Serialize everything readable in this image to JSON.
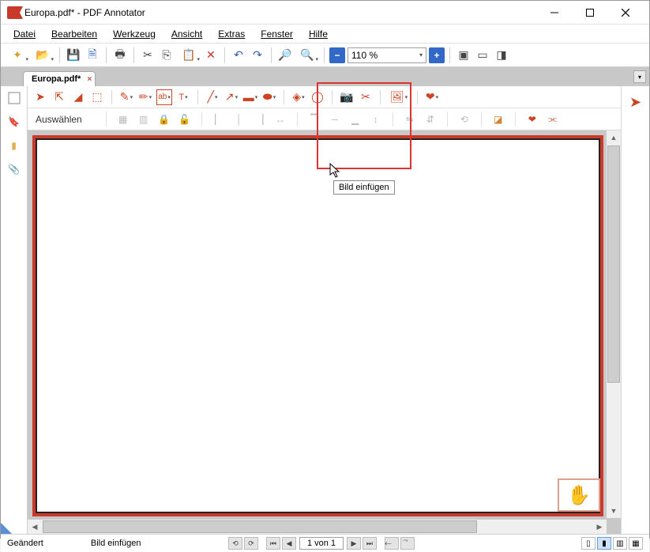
{
  "window": {
    "title": "Europa.pdf* - PDF Annotator"
  },
  "menu": {
    "file": "Datei",
    "edit": "Bearbeiten",
    "tool": "Werkzeug",
    "view": "Ansicht",
    "extras": "Extras",
    "window": "Fenster",
    "help": "Hilfe"
  },
  "toolbar": {
    "zoom_value": "110 %"
  },
  "tabs": {
    "items": [
      {
        "label": "Europa.pdf*"
      }
    ]
  },
  "anno": {
    "sub_label": "Auswählen",
    "tooltip": "Bild einfügen"
  },
  "status": {
    "left": "Geändert",
    "hint": "Bild einfügen",
    "page": "1 von 1"
  }
}
